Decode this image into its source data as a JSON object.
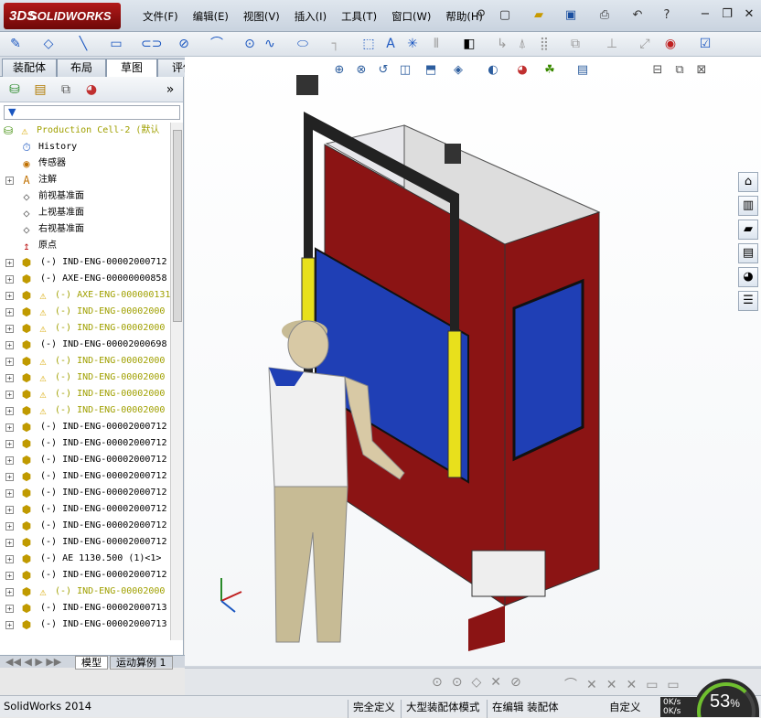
{
  "app": {
    "brand": "SOLIDWORKS",
    "brand_prefix": "3DS"
  },
  "menu": [
    "文件(F)",
    "编辑(E)",
    "视图(V)",
    "插入(I)",
    "工具(T)",
    "窗口(W)",
    "帮助(H)"
  ],
  "tabs": [
    "装配体",
    "布局",
    "草图",
    "评估"
  ],
  "active_tab": "草图",
  "tree": {
    "root": "Production Cell-2  (默认",
    "items": [
      {
        "label": "History",
        "icon": "history-icon",
        "expand": false,
        "warn": false
      },
      {
        "label": "传感器",
        "icon": "sensor-icon",
        "expand": false,
        "warn": false
      },
      {
        "label": "注解",
        "icon": "annotation-icon",
        "expand": true,
        "warn": false
      },
      {
        "label": "前视基准面",
        "icon": "plane-icon",
        "expand": false,
        "warn": false
      },
      {
        "label": "上视基准面",
        "icon": "plane-icon",
        "expand": false,
        "warn": false
      },
      {
        "label": "右视基准面",
        "icon": "plane-icon",
        "expand": false,
        "warn": false
      },
      {
        "label": "原点",
        "icon": "origin-icon",
        "expand": false,
        "warn": false
      },
      {
        "label": "(-) IND-ENG-00002000712",
        "icon": "part-icon",
        "expand": true,
        "warn": false
      },
      {
        "label": "(-) AXE-ENG-00000000858",
        "icon": "part-icon",
        "expand": true,
        "warn": false
      },
      {
        "label": "(-) AXE-ENG-000000131",
        "icon": "part-icon",
        "expand": true,
        "warn": true
      },
      {
        "label": "(-) IND-ENG-00002000",
        "icon": "part-icon",
        "expand": true,
        "warn": true
      },
      {
        "label": "(-) IND-ENG-00002000",
        "icon": "part-icon",
        "expand": true,
        "warn": true
      },
      {
        "label": "(-) IND-ENG-00002000698",
        "icon": "part-icon",
        "expand": true,
        "warn": false
      },
      {
        "label": "(-) IND-ENG-00002000",
        "icon": "part-icon",
        "expand": true,
        "warn": true
      },
      {
        "label": "(-) IND-ENG-00002000",
        "icon": "part-icon",
        "expand": true,
        "warn": true
      },
      {
        "label": "(-) IND-ENG-00002000",
        "icon": "part-icon",
        "expand": true,
        "warn": true
      },
      {
        "label": "(-) IND-ENG-00002000",
        "icon": "part-icon",
        "expand": true,
        "warn": true
      },
      {
        "label": "(-) IND-ENG-00002000712",
        "icon": "part-icon",
        "expand": true,
        "warn": false
      },
      {
        "label": "(-) IND-ENG-00002000712",
        "icon": "part-icon",
        "expand": true,
        "warn": false
      },
      {
        "label": "(-) IND-ENG-00002000712",
        "icon": "part-icon",
        "expand": true,
        "warn": false
      },
      {
        "label": "(-) IND-ENG-00002000712",
        "icon": "part-icon",
        "expand": true,
        "warn": false
      },
      {
        "label": "(-) IND-ENG-00002000712",
        "icon": "part-icon",
        "expand": true,
        "warn": false
      },
      {
        "label": "(-) IND-ENG-00002000712",
        "icon": "part-icon",
        "expand": true,
        "warn": false
      },
      {
        "label": "(-) IND-ENG-00002000712",
        "icon": "part-icon",
        "expand": true,
        "warn": false
      },
      {
        "label": "(-) IND-ENG-00002000712",
        "icon": "part-icon",
        "expand": true,
        "warn": false
      },
      {
        "label": "(-) AE 1130.500 (1)<1>",
        "icon": "part-icon",
        "expand": true,
        "warn": false
      },
      {
        "label": "(-) IND-ENG-00002000712",
        "icon": "part-icon",
        "expand": true,
        "warn": false
      },
      {
        "label": "(-) IND-ENG-00002000",
        "icon": "part-icon",
        "expand": true,
        "warn": true
      },
      {
        "label": "(-) IND-ENG-00002000713",
        "icon": "part-icon",
        "expand": true,
        "warn": false
      },
      {
        "label": "(-) IND-ENG-00002000713",
        "icon": "part-icon",
        "expand": true,
        "warn": false
      }
    ]
  },
  "bottom_tabs": [
    "模型",
    "运动算例 1"
  ],
  "status": {
    "app_version": "SolidWorks 2014",
    "fully_defined": "完全定义",
    "large_assembly": "大型装配体模式",
    "editing": "在编辑 装配体",
    "custom": "自定义"
  },
  "gauge": {
    "percent": "53",
    "speed_up": "0K/s",
    "speed_down": "0K/s"
  },
  "colors": {
    "frame_red": "#8b1414",
    "panel_blue": "#1f3fb5",
    "guard_yellow": "#e8e01c",
    "shirt_white": "#f0f0f0",
    "pants_beige": "#c7bb95"
  }
}
